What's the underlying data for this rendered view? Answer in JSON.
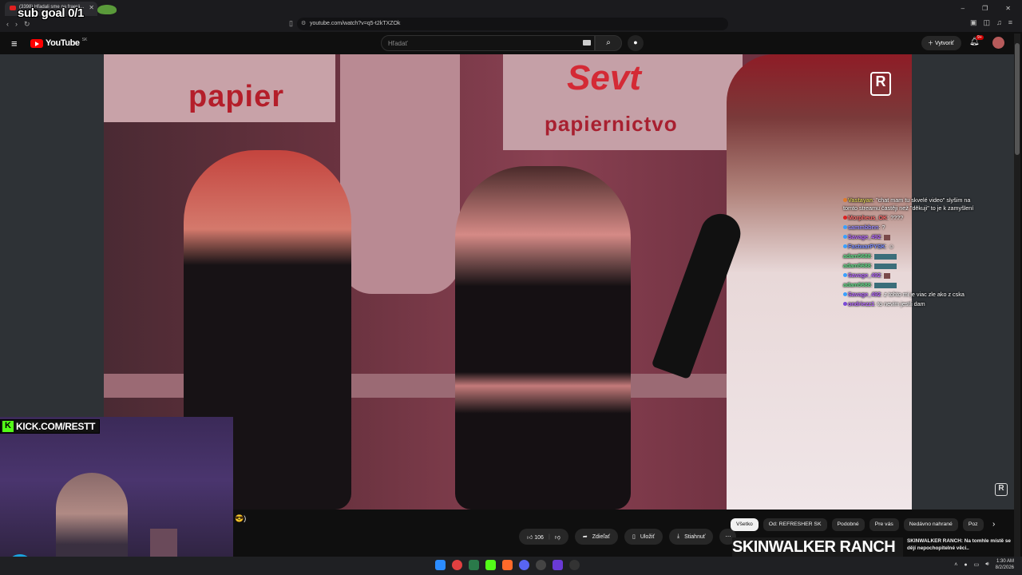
{
  "browser": {
    "tab_title": "(3398) Hľadali sme na fraerá...",
    "url": "youtube.com/watch?v=q5-t2kTXZOk",
    "window_controls": [
      "–",
      "❐",
      "✕"
    ]
  },
  "overlay": {
    "sub_goal": "sub goal 0/1",
    "kick_handle": "KICK.COM/RESTT"
  },
  "youtube": {
    "logo_text": "YouTube",
    "region": "SK",
    "search_placeholder": "Hľadať",
    "create_label": "Vytvoriť",
    "notifications_badge": "9+"
  },
  "video": {
    "sign_left": "papier",
    "sign_right_logo": "Sevt",
    "sign_right": "papiernictvo",
    "brand_glyph": "R"
  },
  "chat": [
    {
      "user": "Vastayan",
      "color": "#d6c85a",
      "text": ": \"chat mam tu skvelé video\" slyšim na tomto streamu častěji než \"děkuji\" to je k zamyšlení",
      "badge": "#e07a2a"
    },
    {
      "user": "Morpheus_OK",
      "color": "#ff6a6a",
      "text": ": ????",
      "badge": "#d22"
    },
    {
      "user": "sammbbnn",
      "color": "#9b8cff",
      "text": ": ?",
      "badge": "#3aa0ff"
    },
    {
      "user": "Savage_492",
      "color": "#b86bff",
      "text": ":",
      "badge": "#3aa0ff",
      "emote": "sq"
    },
    {
      "user": "FastwarPYSK",
      "color": "#7a8cff",
      "text": ":",
      "badge": "#3aa0ff",
      "emote": "smile"
    },
    {
      "user": "adam5688",
      "color": "#64e08c",
      "text": ":",
      "emote": "wide"
    },
    {
      "user": "adam5688",
      "color": "#64e08c",
      "text": ":",
      "emote": "wide"
    },
    {
      "user": "Savage_492",
      "color": "#b86bff",
      "text": ":",
      "badge": "#3aa0ff",
      "emote": "sq"
    },
    {
      "user": "adam5688",
      "color": "#64e08c",
      "text": ":",
      "emote": "wide"
    },
    {
      "user": "Savage_492",
      "color": "#b86bff",
      "text": ": z tohto mi je viac zle ako z cska",
      "badge": "#3aa0ff"
    },
    {
      "user": "ondriezz1",
      "color": "#b86bff",
      "text": ": to nevim jestli dam",
      "badge": "#7b4bd6"
    }
  ],
  "actions": {
    "likes": "106",
    "share": "Zdieľať",
    "save": "Uložiť",
    "download": "Stiahnuť",
    "more": "⋯"
  },
  "chips": [
    "Všetko",
    "Od: REFRESHER SK",
    "Podobné",
    "Pre vás",
    "Nedávno nahrané",
    "Poz"
  ],
  "recommendation": {
    "thumb_text": "SKINWALKER RANCH",
    "title": "SKINWALKER RANCH: Na tomhle místě se dějí nepochopitelné věci.."
  },
  "taskbar": {
    "time": "1:30 AM",
    "date": "8/2/2026"
  }
}
